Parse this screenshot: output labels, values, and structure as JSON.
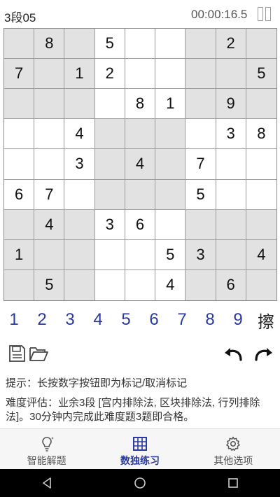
{
  "header": {
    "level": "3段05",
    "timer": "00:00:16.5"
  },
  "board": {
    "cells": [
      [
        "",
        "8",
        "",
        "5",
        "",
        "",
        "",
        "2",
        ""
      ],
      [
        "7",
        "",
        "1",
        "2",
        "",
        "",
        "",
        "",
        "5"
      ],
      [
        "",
        "",
        "",
        "",
        "8",
        "1",
        "",
        "9",
        ""
      ],
      [
        "",
        "",
        "4",
        "",
        "",
        "",
        "",
        "3",
        "8"
      ],
      [
        "",
        "",
        "3",
        "",
        "4",
        "",
        "7",
        "",
        ""
      ],
      [
        "6",
        "7",
        "",
        "",
        "",
        "",
        "5",
        "",
        ""
      ],
      [
        "",
        "4",
        "",
        "3",
        "6",
        "",
        "",
        "",
        ""
      ],
      [
        "1",
        "",
        "",
        "",
        "",
        "5",
        "3",
        "",
        "4"
      ],
      [
        "",
        "5",
        "",
        "",
        "",
        "4",
        "",
        "6",
        ""
      ]
    ],
    "shaded_fill": "#e2e2e2",
    "normal_fill": "#ffffff"
  },
  "numpad": {
    "numbers": [
      "1",
      "2",
      "3",
      "4",
      "5",
      "6",
      "7",
      "8",
      "9"
    ],
    "erase": "擦",
    "number_color": "#2a3aa0"
  },
  "hint": "提示：长按数字按钮即为标记/取消标记",
  "difficulty": "难度评估：业余3段 [宫内排除法, 区块排除法, 行列排除法]。30分钟内完成此难度题3题即合格。",
  "tabs": [
    {
      "label": "智能解题",
      "icon": "lightbulb-icon"
    },
    {
      "label": "数独练习",
      "icon": "grid-icon",
      "active": true
    },
    {
      "label": "其他选项",
      "icon": "gear-icon"
    }
  ],
  "accent_color": "#2a3aa0"
}
